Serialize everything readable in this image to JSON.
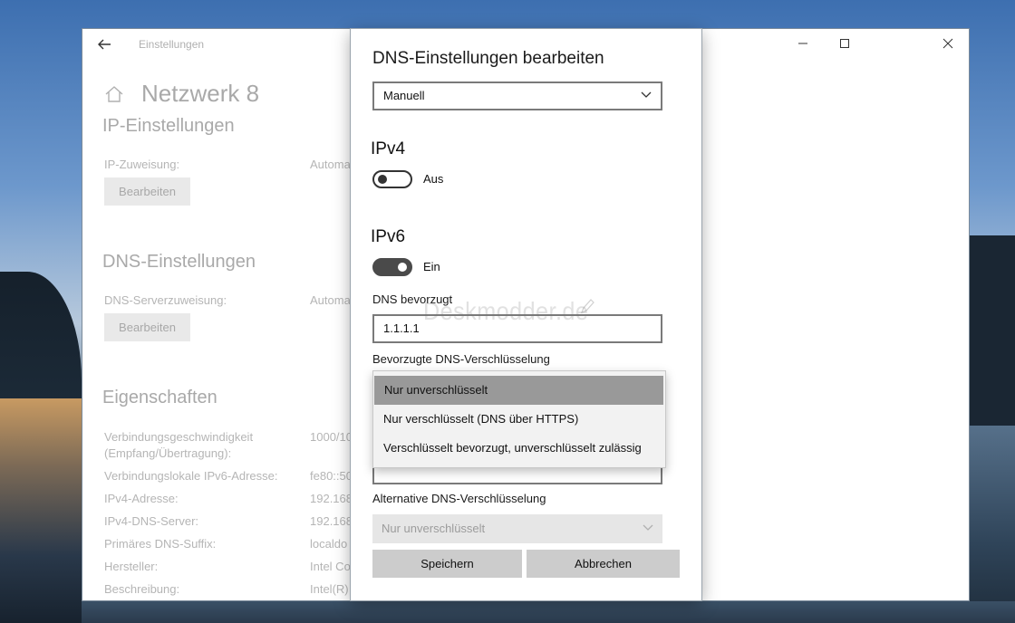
{
  "window": {
    "title": "Einstellungen",
    "page_title": "Netzwerk 8"
  },
  "ip": {
    "section": "IP-Einstellungen",
    "assignment_label": "IP-Zuweisung:",
    "assignment_value": "Automa",
    "edit_label": "Bearbeiten"
  },
  "dns": {
    "section": "DNS-Einstellungen",
    "assignment_label": "DNS-Serverzuweisung:",
    "assignment_value": "Automa",
    "edit_label": "Bearbeiten"
  },
  "props": {
    "section": "Eigenschaften",
    "rows": [
      {
        "label": "Verbindungsgeschwindigkeit",
        "label2": "(Empfang/Übertragung):",
        "value": "1000/10"
      },
      {
        "label": "Verbindungslokale IPv6-Adresse:",
        "value": "fe80::50"
      },
      {
        "label": "IPv4-Adresse:",
        "value": "192.168"
      },
      {
        "label": "IPv4-DNS-Server:",
        "value": "192.168"
      },
      {
        "label": "Primäres DNS-Suffix:",
        "value": "localdo"
      },
      {
        "label": "Hersteller:",
        "value": "Intel Co"
      },
      {
        "label": "Beschreibung:",
        "value": "Intel(R)"
      }
    ]
  },
  "dialog": {
    "title": "DNS-Einstellungen bearbeiten",
    "mode": "Manuell",
    "ipv4": {
      "heading": "IPv4",
      "toggle_label": "Aus"
    },
    "ipv6": {
      "heading": "IPv6",
      "toggle_label": "Ein"
    },
    "preferred_label": "DNS bevorzugt",
    "preferred_value": "1.1.1.1",
    "preferred_enc_label": "Bevorzugte DNS-Verschlüsselung",
    "alt_enc_label": "Alternative DNS-Verschlüsselung",
    "alt_enc_value": "Nur unverschlüsselt",
    "save": "Speichern",
    "cancel": "Abbrechen",
    "watermark": "Deskmodder.de"
  },
  "dropdown": {
    "options": [
      "Nur unverschlüsselt",
      "Nur verschlüsselt (DNS über HTTPS)",
      "Verschlüsselt bevorzugt, unverschlüsselt zulässig"
    ],
    "selected_index": 0
  },
  "colors": {
    "toggle_on": "#4a4a4a",
    "selected_option": "#999999",
    "dimmed_text": "#b5b5b5"
  }
}
